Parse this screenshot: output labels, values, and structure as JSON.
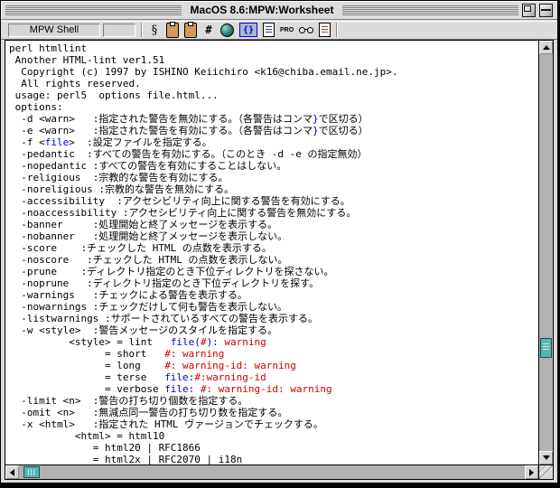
{
  "window": {
    "title": "MacOS 8.6:MPW:Worksheet"
  },
  "toolbar": {
    "status_label": "MPW Shell",
    "icons": [
      {
        "name": "section-icon",
        "glyph": "§"
      },
      {
        "name": "copy-icon"
      },
      {
        "name": "paste-icon"
      },
      {
        "name": "hash-icon",
        "glyph": "#"
      },
      {
        "name": "globe-icon"
      },
      {
        "name": "braces-icon",
        "glyph": "{}",
        "active": true
      },
      {
        "name": "document-icon"
      },
      {
        "name": "pro-icon",
        "glyph": "PRO"
      },
      {
        "name": "glasses-icon"
      },
      {
        "name": "marked-document-icon"
      }
    ]
  },
  "colors": {
    "black": "#000000",
    "blue": "#0000CC",
    "red": "#CC0000",
    "thumb": "#57B5B1"
  },
  "output": {
    "lines": [
      [
        {
          "t": "perl htmllint"
        }
      ],
      [
        {
          "t": " Another HTML-lint ver1.51"
        }
      ],
      [
        {
          "t": "  Copyright (c) 1997 by ISHINO Keiichiro <k16@chiba.email.ne.jp>."
        }
      ],
      [
        {
          "t": "  All rights reserved."
        }
      ],
      [
        {
          "t": " usage: perl5  options file.html..."
        }
      ],
      [
        {
          "t": " options:"
        }
      ],
      [
        {
          "t": "  -d <warn>   :指定された警告を無効にする。（各警告はコンマ"
        },
        {
          "t": "}",
          "c": "blue"
        },
        {
          "t": "で区切る）"
        }
      ],
      [
        {
          "t": "  -e <warn>   :指定された警告を有効にする。（各警告はコンマ"
        },
        {
          "t": "}",
          "c": "blue"
        },
        {
          "t": "で区切る）"
        }
      ],
      [
        {
          "t": "  -f <"
        },
        {
          "t": "file",
          "c": "blue"
        },
        {
          "t": ">  :設定ファイルを指定する。"
        }
      ],
      [
        {
          "t": "  -pedantic  :すべての警告を有効にする。（このとき -d -e の指定無効）"
        }
      ],
      [
        {
          "t": "  -nopedantic :すべての警告を有効にすることはしない。"
        }
      ],
      [
        {
          "t": "  -religious  :宗教的な警告を有効にする。"
        }
      ],
      [
        {
          "t": "  -noreligious :宗教的な警告を無効にする。"
        }
      ],
      [
        {
          "t": "  -accessibility  :アクセシビリティ向上に関する警告を有効にする。"
        }
      ],
      [
        {
          "t": "  -noaccessibility :アクセシビリティ向上に関する警告を無効にする。"
        }
      ],
      [
        {
          "t": "  -banner     :処理開始と終了メッセージを表示する。"
        }
      ],
      [
        {
          "t": "  -nobanner   :処理開始と終了メッセージを表示しない。"
        }
      ],
      [
        {
          "t": "  -score    :チェックした HTML の点数を表示する。"
        }
      ],
      [
        {
          "t": "  -noscore   :チェックした HTML の点数を表示しない。"
        }
      ],
      [
        {
          "t": "  -prune    :ディレクトリ指定のとき下位ディレクトリを探さない。"
        }
      ],
      [
        {
          "t": "  -noprune   :ディレクトリ指定のとき下位ディレクトリを探す。"
        }
      ],
      [
        {
          "t": "  -warnings   :チェックによる警告を表示する。"
        }
      ],
      [
        {
          "t": "  -nowarnings :チェックだけして何も警告を表示しない。"
        }
      ],
      [
        {
          "t": "  -listwarnings :サポートされているすべての警告を表示する。"
        }
      ],
      [
        {
          "t": "  -w <style>  :警告メッセージのスタイルを指定する。"
        }
      ],
      [
        {
          "t": "          <style> = lint   "
        },
        {
          "t": "file(",
          "c": "blue"
        },
        {
          "t": "#",
          "c": "red"
        },
        {
          "t": "):",
          "c": "blue"
        },
        {
          "t": " warning",
          "c": "red"
        }
      ],
      [
        {
          "t": "                = short   "
        },
        {
          "t": "#: warning",
          "c": "red"
        }
      ],
      [
        {
          "t": "                = long    "
        },
        {
          "t": "#: warning-id: warning",
          "c": "red"
        }
      ],
      [
        {
          "t": "                = terse   "
        },
        {
          "t": "file:",
          "c": "blue"
        },
        {
          "t": "#:warning-id",
          "c": "red"
        }
      ],
      [
        {
          "t": "                = verbose "
        },
        {
          "t": "file: ",
          "c": "blue"
        },
        {
          "t": "#: warning-id: warning",
          "c": "red"
        }
      ],
      [
        {
          "t": "  -limit <n>  :警告の打ち切り個数を指定する。"
        }
      ],
      [
        {
          "t": "  -omit <n>   :無減点同一警告の打ち切り数を指定する。"
        }
      ],
      [
        {
          "t": "  -x <html>   :指定された HTML ヴァージョンでチェックする。"
        }
      ],
      [
        {
          "t": "           <html> = html10"
        }
      ],
      [
        {
          "t": "              = html20 | RFC1866"
        }
      ],
      [
        {
          "t": "              = html2x | RFC2070 | i18n"
        }
      ]
    ]
  }
}
